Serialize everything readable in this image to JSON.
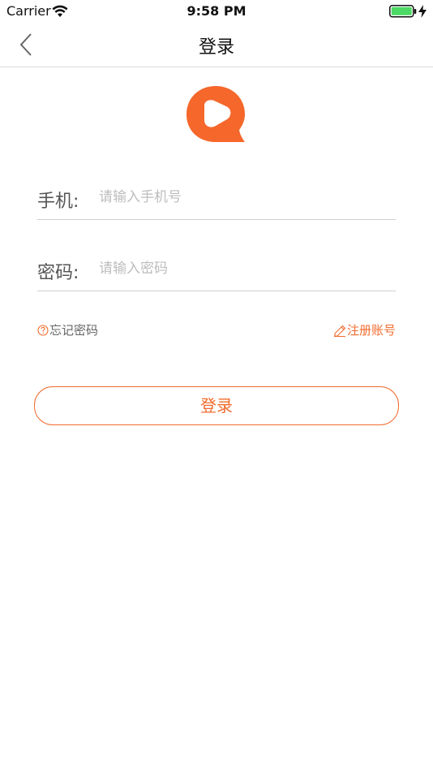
{
  "status_bar": {
    "carrier": "Carrier",
    "time": "9:58 PM"
  },
  "nav": {
    "title": "登录",
    "back_icon": "chevron-left-icon"
  },
  "logo": {
    "icon": "brand-logo-icon"
  },
  "form": {
    "phone": {
      "label": "手机:",
      "placeholder": "请输入手机号",
      "value": ""
    },
    "password": {
      "label": "密码:",
      "placeholder": "请输入密码",
      "value": ""
    }
  },
  "links": {
    "forgot": "忘记密码",
    "register": "注册账号"
  },
  "login_button": {
    "label": "登录"
  },
  "colors": {
    "accent": "#f26b2d",
    "battery": "#4cd964",
    "divider": "#cfcfcf"
  }
}
